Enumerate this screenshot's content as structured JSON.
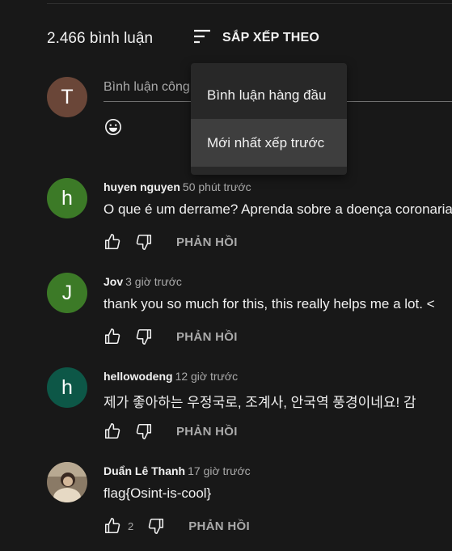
{
  "header": {
    "comment_count": "2.466 bình luận",
    "sort_label": "SẮP XẾP THEO"
  },
  "sort_menu": {
    "items": [
      {
        "label": "Bình luận hàng đầu",
        "selected": false
      },
      {
        "label": "Mới nhất xếp trước",
        "selected": true
      }
    ]
  },
  "composer": {
    "avatar_letter": "T",
    "avatar_color": "#6a4638",
    "placeholder": "Bình luận công khai...",
    "emoji_icon": "smiley-icon"
  },
  "comments": [
    {
      "author": "huyen nguyen",
      "time": "50 phút trước",
      "text": "O que é um derrame? Aprenda sobre a doença coronariana",
      "avatar_letter": "h",
      "avatar_color": "#3c7a27",
      "reply_label": "PHẢN HỒI"
    },
    {
      "author": "Jov",
      "time": "3 giờ trước",
      "text": "thank you so much for this, this really helps me a lot. <",
      "avatar_letter": "J",
      "avatar_color": "#3c7a27",
      "reply_label": "PHẢN HỒI"
    },
    {
      "author": "hellowodeng",
      "time": "12 giờ trước",
      "text": "제가 좋아하는 우정국로, 조계사, 안국역 풍경이네요! 감",
      "avatar_letter": "h",
      "avatar_color": "#0d5747",
      "reply_label": "PHẢN HỒI"
    },
    {
      "author": "Duẩn Lê Thanh",
      "time": "17 giờ trước",
      "text": "flag{Osint-is-cool}",
      "avatar_letter": "",
      "avatar_color": "#8a7a66",
      "like_count": "2",
      "reply_label": "PHẢN HỒI"
    }
  ],
  "colors": {
    "background": "#181818",
    "text": "#f1f1f1",
    "secondary_text": "#aaaaaa",
    "menu_background": "#282828",
    "menu_selected": "#3e3e3e"
  }
}
